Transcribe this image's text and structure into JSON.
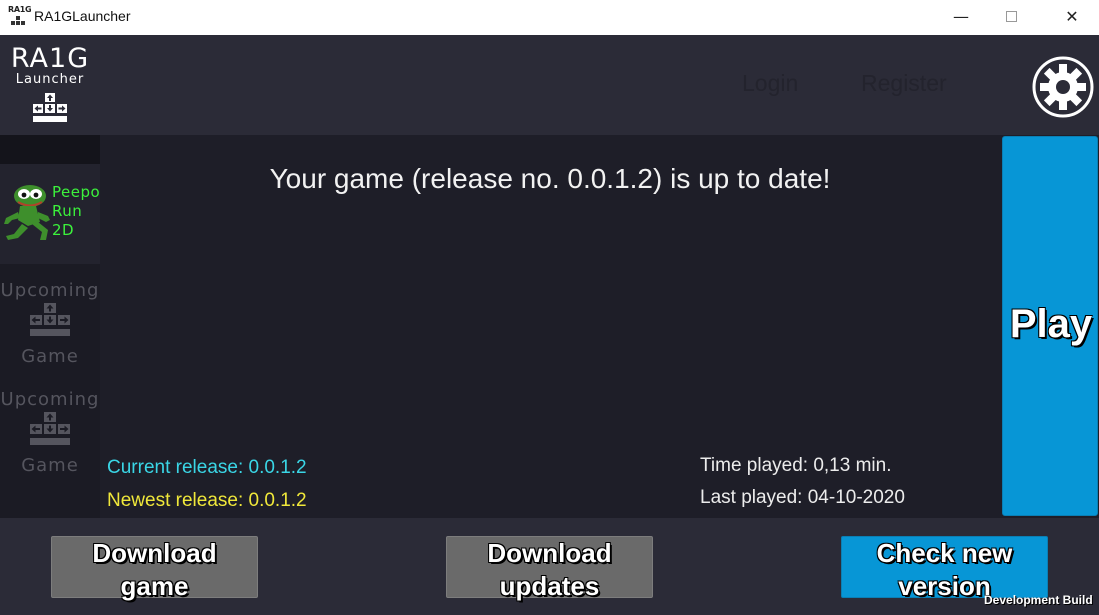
{
  "window": {
    "title": "RA1GLauncher",
    "icon_text": "RA1G",
    "minimize": "—",
    "close": "✕"
  },
  "header": {
    "logo_title": "RA1G",
    "logo_subtitle": "Launcher",
    "login": "Login",
    "register": "Register"
  },
  "sidebar": {
    "games": [
      {
        "name_line1": "Peepo",
        "name_line2": "Run",
        "name_line3": "2D"
      }
    ],
    "upcoming": [
      {
        "top": "Upcoming",
        "bottom": "Game"
      },
      {
        "top": "Upcoming",
        "bottom": "Game"
      }
    ]
  },
  "main": {
    "status": "Your game (release no. 0.0.1.2) is up to date!",
    "current_release": "Current release: 0.0.1.2",
    "newest_release": "Newest release: 0.0.1.2",
    "time_played": "Time played: 0,13 min.",
    "last_played": "Last played: 04-10-2020",
    "play": "Play"
  },
  "footer": {
    "download_game_line1": "Download",
    "download_game_line2": "game",
    "download_updates_line1": "Download",
    "download_updates_line2": "updates",
    "check_line1": "Check new",
    "check_line2": "version",
    "dev_build": "Development Build"
  },
  "colors": {
    "accent": "#0796d6",
    "background": "#1e1e28",
    "panel": "#2b2b37",
    "current_release": "#3ad6e6",
    "newest_release": "#f0e83a",
    "game_name": "#3cf23c"
  }
}
